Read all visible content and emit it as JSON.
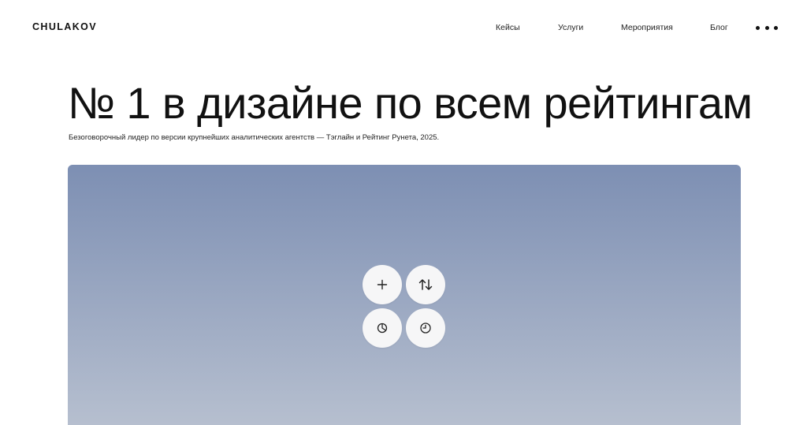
{
  "header": {
    "logo": "CHULAKOV",
    "nav": [
      {
        "label": "Кейсы"
      },
      {
        "label": "Услуги"
      },
      {
        "label": "Мероприятия"
      },
      {
        "label": "Блог"
      }
    ],
    "more_icon": "more-dots-icon"
  },
  "hero": {
    "title": "№ 1 в дизайне по всем рейтингам",
    "subtitle": "Безоговорочный лидер по версии крупнейших аналитических агентств — Тэглайн и Рейтинг Рунета, 2025."
  },
  "media": {
    "gradient_top": "#7d8fb3",
    "gradient_bottom": "#b6bfcf",
    "controls": [
      {
        "icon": "plus-icon"
      },
      {
        "icon": "sort-arrows-icon"
      },
      {
        "icon": "pie-chart-icon"
      },
      {
        "icon": "clock-icon"
      }
    ]
  }
}
